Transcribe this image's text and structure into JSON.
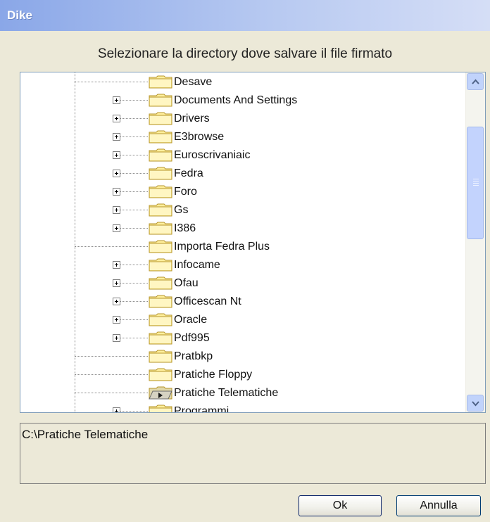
{
  "window": {
    "title": "Dike"
  },
  "prompt": "Selezionare la directory dove salvare il file firmato",
  "tree": {
    "items": [
      {
        "label": "Desave",
        "expandable": false,
        "open": false
      },
      {
        "label": "Documents And Settings",
        "expandable": true,
        "open": false
      },
      {
        "label": "Drivers",
        "expandable": true,
        "open": false
      },
      {
        "label": "E3browse",
        "expandable": true,
        "open": false
      },
      {
        "label": "Euroscrivaniaic",
        "expandable": true,
        "open": false
      },
      {
        "label": "Fedra",
        "expandable": true,
        "open": false
      },
      {
        "label": "Foro",
        "expandable": true,
        "open": false
      },
      {
        "label": "Gs",
        "expandable": true,
        "open": false
      },
      {
        "label": "I386",
        "expandable": true,
        "open": false
      },
      {
        "label": "Importa Fedra Plus",
        "expandable": false,
        "open": false
      },
      {
        "label": "Infocame",
        "expandable": true,
        "open": false
      },
      {
        "label": "Ofau",
        "expandable": true,
        "open": false
      },
      {
        "label": "Officescan Nt",
        "expandable": true,
        "open": false
      },
      {
        "label": "Oracle",
        "expandable": true,
        "open": false
      },
      {
        "label": "Pdf995",
        "expandable": true,
        "open": false
      },
      {
        "label": "Pratbkp",
        "expandable": false,
        "open": false
      },
      {
        "label": "Pratiche Floppy",
        "expandable": false,
        "open": false
      },
      {
        "label": "Pratiche Telematiche",
        "expandable": false,
        "open": true
      },
      {
        "label": "Programmi",
        "expandable": true,
        "open": false
      }
    ],
    "selected": "Pratiche Telematiche"
  },
  "selected_path": "C:\\Pratiche Telematiche",
  "buttons": {
    "ok": "Ok",
    "cancel": "Annulla"
  },
  "icons": {
    "folder": "folder-icon",
    "folder_open": "folder-open-icon",
    "expand": "plus-icon"
  },
  "colors": {
    "title_gradient_start": "#8aa7e8",
    "folder_fill": "#ffef9c",
    "folder_stroke": "#b6942b"
  }
}
